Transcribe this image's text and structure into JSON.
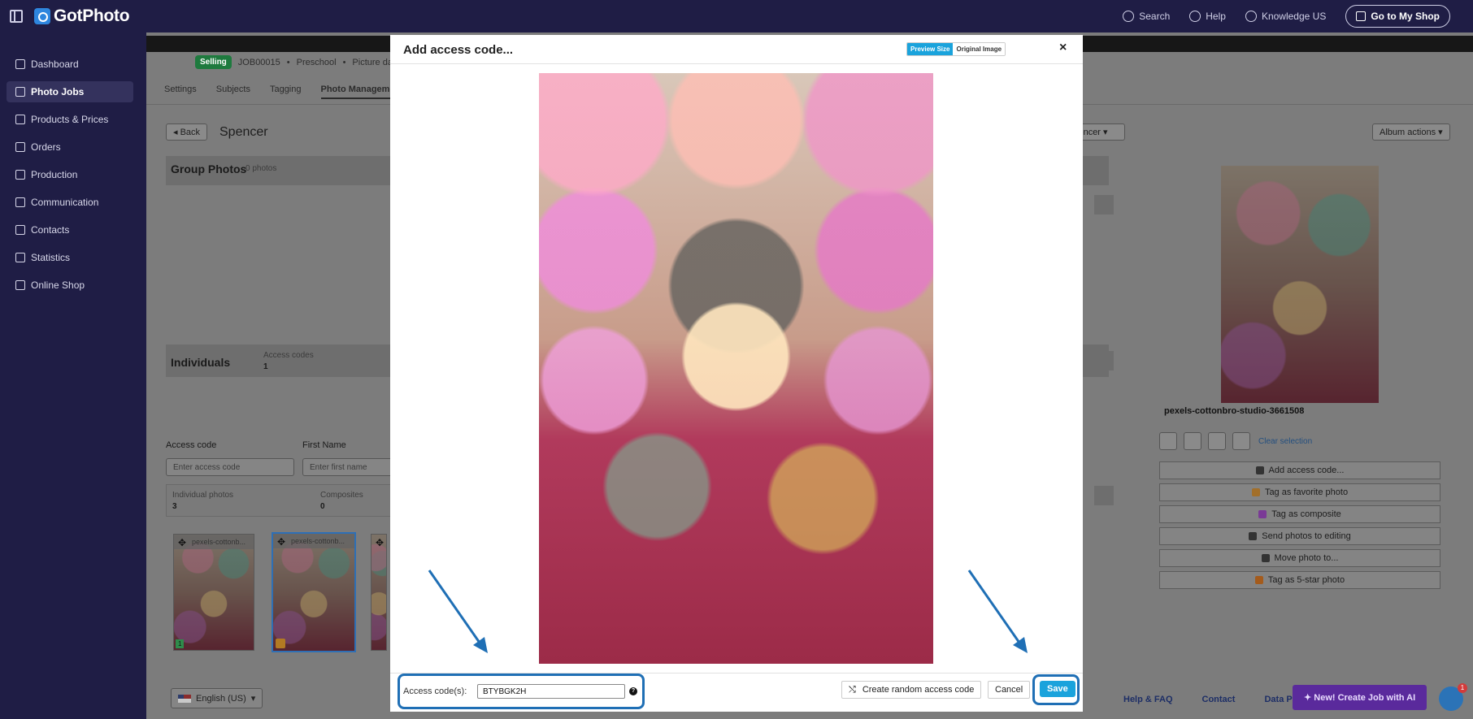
{
  "brand": {
    "name": "GotPhoto"
  },
  "topbar": {
    "search_label": "Search",
    "help_label": "Help",
    "knowledge_label": "Knowledge US",
    "shop_button": "Go to My Shop"
  },
  "sidebar": {
    "items": [
      {
        "label": "Dashboard",
        "icon": "home-icon"
      },
      {
        "label": "Photo Jobs",
        "icon": "photo-icon",
        "active": true
      },
      {
        "label": "Products & Prices",
        "icon": "cart-icon"
      },
      {
        "label": "Orders",
        "icon": "basket-icon"
      },
      {
        "label": "Production",
        "icon": "printer-icon"
      },
      {
        "label": "Communication",
        "icon": "message-icon"
      },
      {
        "label": "Contacts",
        "icon": "person-icon"
      },
      {
        "label": "Statistics",
        "icon": "chart-icon"
      },
      {
        "label": "Online Shop",
        "icon": "store-icon"
      }
    ]
  },
  "job": {
    "status": "Selling",
    "id": "JOB00015",
    "type": "Preschool",
    "event": "Picture day",
    "tabs": [
      "Settings",
      "Subjects",
      "Tagging",
      "Photo Management"
    ],
    "back_label": "Back",
    "album_name": "Spencer",
    "person_select_value": "Spencer",
    "album_actions_label": "Album actions"
  },
  "group_photos": {
    "title": "Group Photos",
    "count": "0 photos"
  },
  "individuals": {
    "title": "Individuals",
    "access_codes_label": "Access codes",
    "access_codes_value": "1",
    "access_code_field_label": "Access code",
    "access_code_placeholder": "Enter access code",
    "first_name_label": "First Name",
    "first_name_placeholder": "Enter first name",
    "individual_photos_label": "Individual photos",
    "individual_photos_value": "3",
    "composites_label": "Composites",
    "composites_value": "0",
    "thumbs": [
      {
        "caption": "pexels-cottonb...",
        "badge": "1"
      },
      {
        "caption": "pexels-cottonb...",
        "selected": true
      },
      {
        "caption": ""
      }
    ]
  },
  "right_panel": {
    "file_name": "pexels-cottonbro-studio-3661508",
    "clear_selection": "Clear selection",
    "actions": [
      {
        "label": "Add access code...",
        "icon": "grid-icon",
        "color": "#333333"
      },
      {
        "label": "Tag as favorite photo",
        "icon": "star-icon",
        "color": "#f0a63a"
      },
      {
        "label": "Tag as composite",
        "icon": "layers-icon",
        "color": "#a23bd1"
      },
      {
        "label": "Send photos to editing",
        "icon": "edit-icon",
        "color": "#333333"
      },
      {
        "label": "Move photo to...",
        "icon": "move-file-icon",
        "color": "#333333"
      },
      {
        "label": "Tag as 5-star photo",
        "icon": "five-star-icon",
        "color": "#f07a1a"
      }
    ]
  },
  "footer": {
    "language": "English (US)",
    "links": [
      "Help & FAQ",
      "Contact",
      "Data Pri"
    ],
    "ai_button": "New! Create Job with AI",
    "chat_unread": "1"
  },
  "modal": {
    "title": "Add access code...",
    "size_options": [
      "Preview Size",
      "Original Image"
    ],
    "close_symbol": "×",
    "access_label": "Access code(s):",
    "access_value": "BTYBGK2H",
    "help_symbol": "?",
    "random_button": "Create random access code",
    "cancel_button": "Cancel",
    "save_button": "Save",
    "accent_color": "#1aa3dc",
    "highlight_color": "#1f6fb5"
  }
}
